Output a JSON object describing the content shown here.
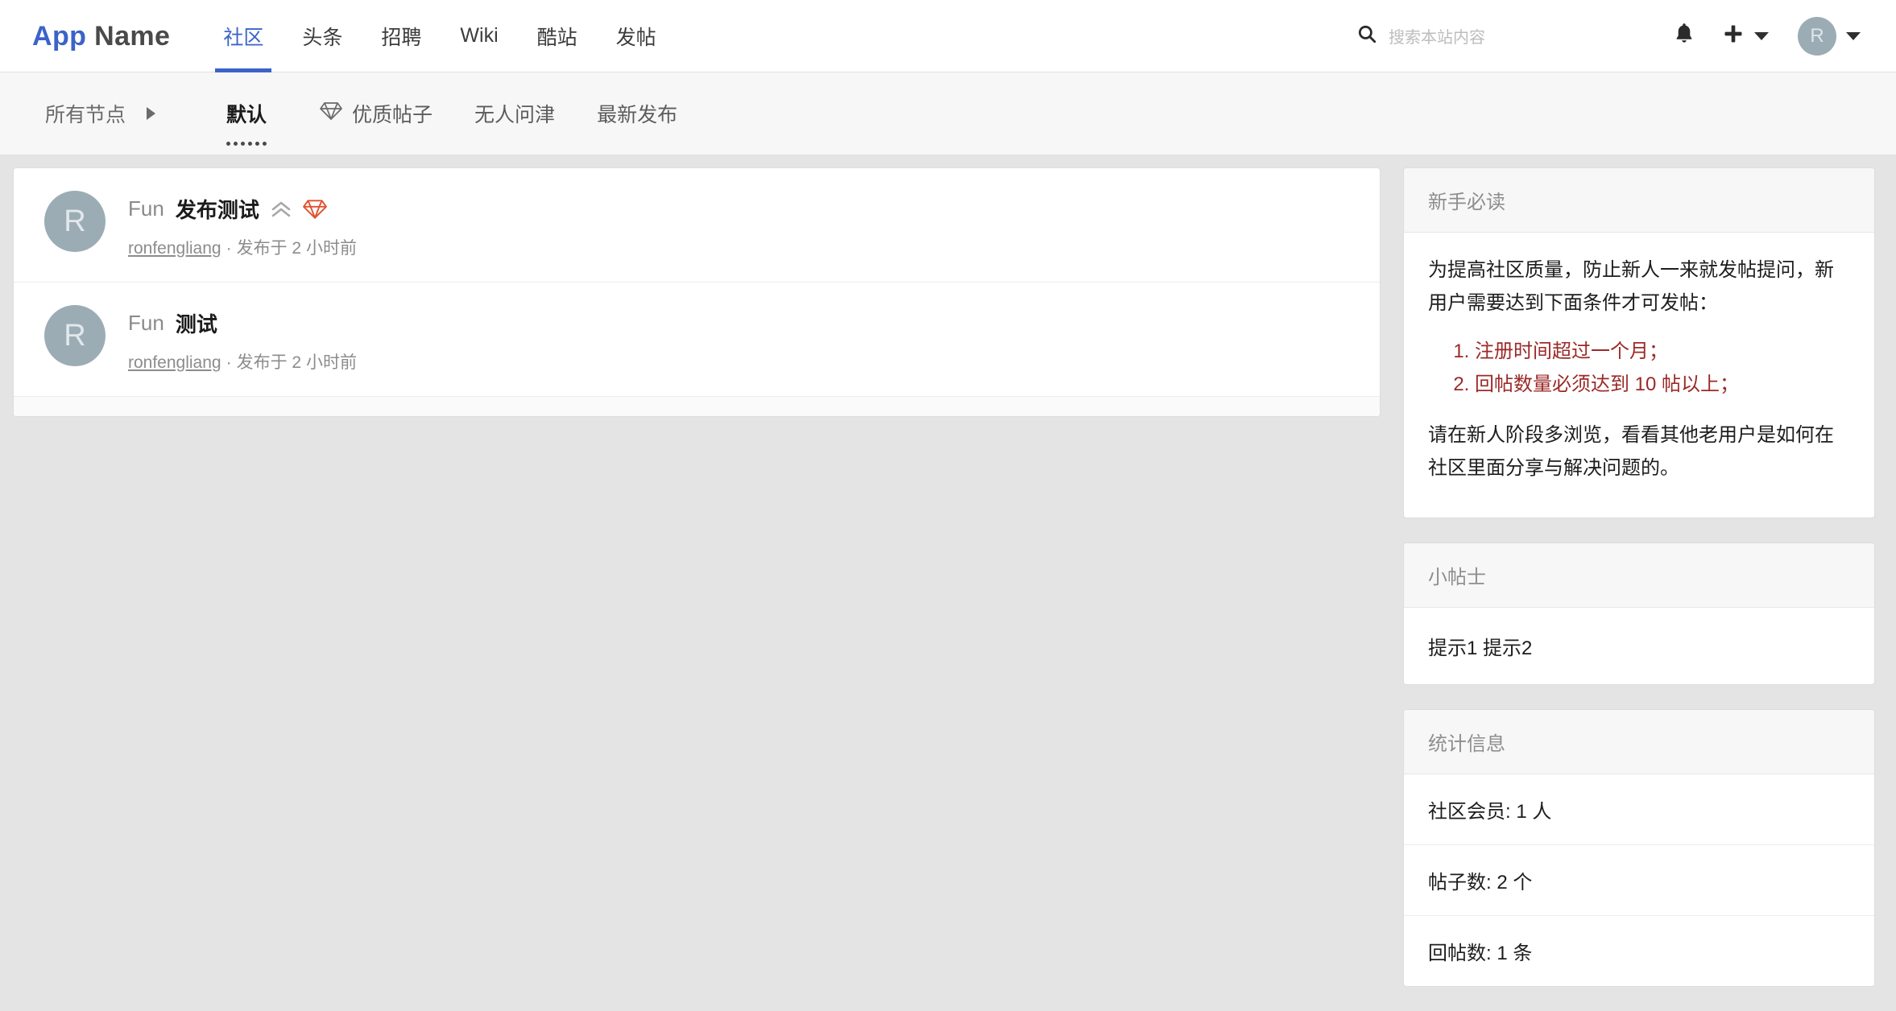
{
  "header": {
    "brand_app": "App",
    "brand_name": "Name",
    "nav": [
      {
        "label": "社区",
        "active": true
      },
      {
        "label": "头条",
        "active": false
      },
      {
        "label": "招聘",
        "active": false
      },
      {
        "label": "Wiki",
        "active": false
      },
      {
        "label": "酷站",
        "active": false
      },
      {
        "label": "发帖",
        "active": false
      }
    ],
    "search": {
      "placeholder": "搜索本站内容",
      "value": "",
      "icon": "search-icon"
    },
    "notification_icon": "bell-icon",
    "add_icon": "plus-icon",
    "avatar_letter": "R",
    "accent_color": "#3b63c8"
  },
  "subnav": {
    "nodes_label": "所有节点",
    "items": [
      {
        "label": "默认",
        "current": true,
        "icon": ""
      },
      {
        "label": "优质帖子",
        "current": false,
        "icon": "diamond-icon"
      },
      {
        "label": "无人问津",
        "current": false,
        "icon": ""
      },
      {
        "label": "最新发布",
        "current": false,
        "icon": ""
      }
    ]
  },
  "posts": [
    {
      "avatar_letter": "R",
      "node": "Fun",
      "title": "发布测试",
      "badges": [
        "chevron-up-icon",
        "diamond-icon"
      ],
      "author": "ronfengliang",
      "separator": "·",
      "time": "发布于 2 小时前"
    },
    {
      "avatar_letter": "R",
      "node": "Fun",
      "title": "测试",
      "badges": [],
      "author": "ronfengliang",
      "separator": "·",
      "time": "发布于 2 小时前"
    }
  ],
  "sidebar": {
    "guide": {
      "title": "新手必读",
      "intro": "为提高社区质量，防止新人一来就发帖提问，新用户需要达到下面条件才可发帖：",
      "rules": [
        "注册时间超过一个月；",
        "回帖数量必须达到 10 帖以上；"
      ],
      "outro": "请在新人阶段多浏览，看看其他老用户是如何在社区里面分享与解决问题的。",
      "rule_color": "#9b2a28"
    },
    "tips": {
      "title": "小帖士",
      "body": "提示1 提示2"
    },
    "stats": {
      "title": "统计信息",
      "items": [
        "社区会员: 1 人",
        "帖子数: 2 个",
        "回帖数: 1 条"
      ]
    }
  }
}
